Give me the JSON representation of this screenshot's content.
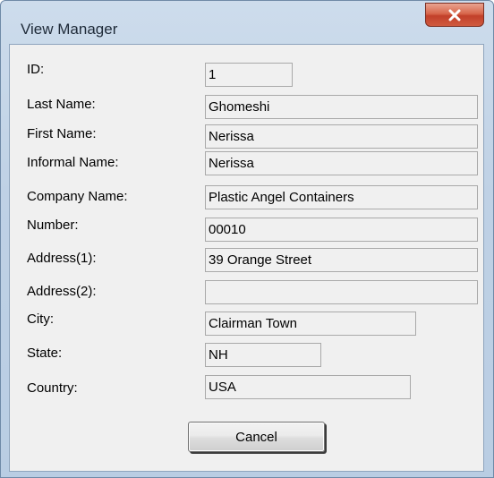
{
  "window": {
    "title": "View Manager"
  },
  "fields": [
    {
      "label": "ID:",
      "value": "1"
    },
    {
      "label": "Last Name:",
      "value": "Ghomeshi"
    },
    {
      "label": "First Name:",
      "value": "Nerissa"
    },
    {
      "label": "Informal Name:",
      "value": "Nerissa"
    },
    {
      "label": "Company Name:",
      "value": "Plastic Angel Containers"
    },
    {
      "label": "Number:",
      "value": "00010"
    },
    {
      "label": "Address(1):",
      "value": "39 Orange Street"
    },
    {
      "label": "Address(2):",
      "value": ""
    },
    {
      "label": "City:",
      "value": "Clairman Town"
    },
    {
      "label": "State:",
      "value": "NH"
    },
    {
      "label": "Country:",
      "value": "USA"
    }
  ],
  "buttons": {
    "cancel_label": "Cancel"
  },
  "icons": {
    "close": "close-icon"
  }
}
